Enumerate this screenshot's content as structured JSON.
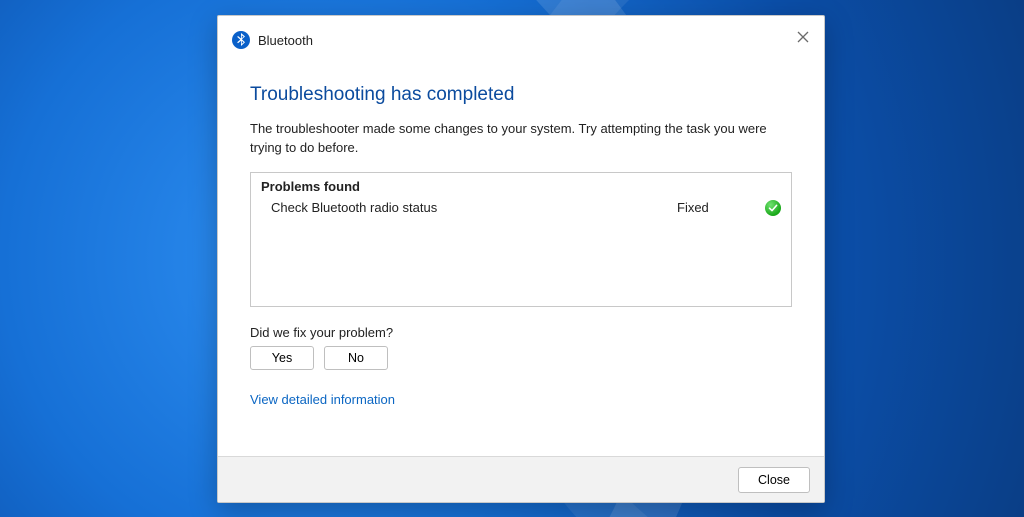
{
  "dialog": {
    "title": "Bluetooth",
    "headline": "Troubleshooting has completed",
    "description": "The troubleshooter made some changes to your system. Try attempting the task you were trying to do before.",
    "problems": {
      "heading": "Problems found",
      "items": [
        {
          "name": "Check Bluetooth radio status",
          "status": "Fixed",
          "statusIcon": "check"
        }
      ]
    },
    "feedback": {
      "question": "Did we fix your problem?",
      "yes": "Yes",
      "no": "No"
    },
    "detailsLink": "View detailed information",
    "closeLabel": "Close"
  }
}
